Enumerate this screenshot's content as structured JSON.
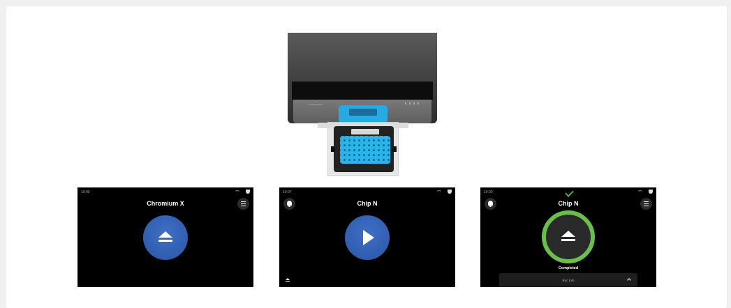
{
  "device": {
    "name": "Chromium X instrument with chip"
  },
  "screens": [
    {
      "time": "10:00",
      "title": "Chromium X",
      "icon": "eject-icon"
    },
    {
      "time": "10:07",
      "title": "Chip N",
      "icon": "play-icon"
    },
    {
      "time": "10:00",
      "title": "Chip N",
      "icon": "eject-icon",
      "status": "Completed",
      "run_info_label": "Run Info"
    }
  ],
  "colors": {
    "primary_button": "#2f5fb3",
    "completed_ring": "#6abf4b",
    "screen_bg": "#000000"
  }
}
